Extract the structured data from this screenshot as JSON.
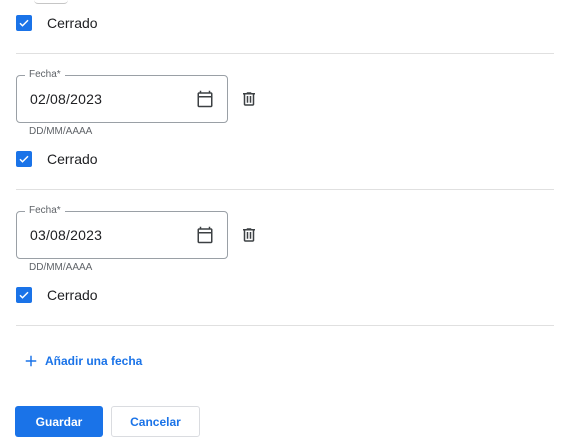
{
  "entries": [
    {
      "closed_label": "Cerrado",
      "closed_checked": true
    },
    {
      "field_label": "Fecha*",
      "date_value": "02/08/2023",
      "helper": "DD/MM/AAAA",
      "closed_label": "Cerrado",
      "closed_checked": true
    },
    {
      "field_label": "Fecha*",
      "date_value": "03/08/2023",
      "helper": "DD/MM/AAAA",
      "closed_label": "Cerrado",
      "closed_checked": true
    }
  ],
  "add_date_label": "Añadir una fecha",
  "actions": {
    "save_label": "Guardar",
    "cancel_label": "Cancelar"
  },
  "colors": {
    "accent": "#1a73e8",
    "divider": "#e0e0e0",
    "field_border": "#9aa0a6",
    "icon": "#3c4043"
  },
  "icons": [
    "check-icon",
    "calendar-icon",
    "trash-icon",
    "plus-icon"
  ]
}
